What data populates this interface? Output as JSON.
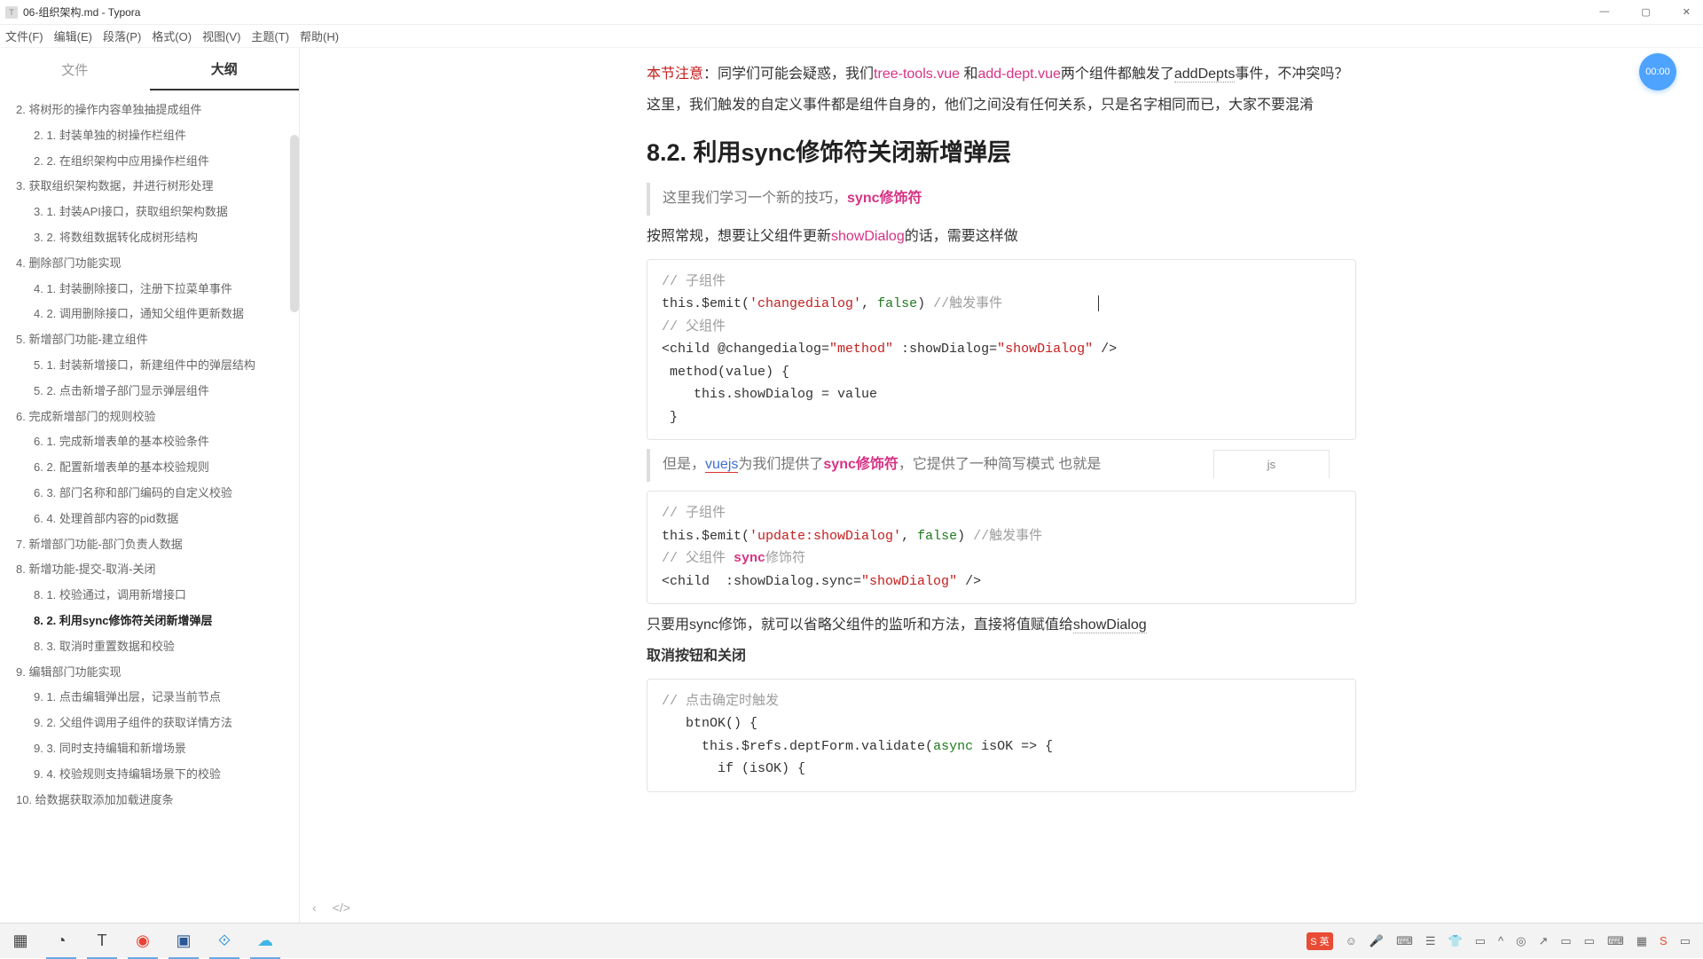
{
  "titlebar": {
    "icon": "T",
    "title": "06-组织架构.md - Typora"
  },
  "winbtns": {
    "min": "—",
    "max": "▢",
    "close": "✕"
  },
  "menus": [
    "文件(F)",
    "编辑(E)",
    "段落(P)",
    "格式(O)",
    "视图(V)",
    "主题(T)",
    "帮助(H)"
  ],
  "sideTabs": {
    "file": "文件",
    "outline": "大纲"
  },
  "outline": [
    {
      "n": "2.",
      "t": "将树形的操作内容单独抽提成组件",
      "l": 1
    },
    {
      "n": "2. 1.",
      "t": "封装单独的树操作栏组件",
      "l": 2
    },
    {
      "n": "2. 2.",
      "t": "在组织架构中应用操作栏组件",
      "l": 2
    },
    {
      "n": "3.",
      "t": "获取组织架构数据，并进行树形处理",
      "l": 1
    },
    {
      "n": "3. 1.",
      "t": "封装API接口，获取组织架构数据",
      "l": 2
    },
    {
      "n": "3. 2.",
      "t": "将数组数据转化成树形结构",
      "l": 2
    },
    {
      "n": "4.",
      "t": "删除部门功能实现",
      "l": 1
    },
    {
      "n": "4. 1.",
      "t": "封装删除接口，注册下拉菜单事件",
      "l": 2
    },
    {
      "n": "4. 2.",
      "t": "调用删除接口，通知父组件更新数据",
      "l": 2
    },
    {
      "n": "5.",
      "t": "新增部门功能-建立组件",
      "l": 1
    },
    {
      "n": "5. 1.",
      "t": "封装新增接口，新建组件中的弹层结构",
      "l": 2
    },
    {
      "n": "5. 2.",
      "t": "点击新增子部门显示弹层组件",
      "l": 2
    },
    {
      "n": "6.",
      "t": "完成新增部门的规则校验",
      "l": 1
    },
    {
      "n": "6. 1.",
      "t": "完成新增表单的基本校验条件",
      "l": 2
    },
    {
      "n": "6. 2.",
      "t": "配置新增表单的基本校验规则",
      "l": 2
    },
    {
      "n": "6. 3.",
      "t": "部门名称和部门编码的自定义校验",
      "l": 2
    },
    {
      "n": "6. 4.",
      "t": "处理首部内容的pid数据",
      "l": 2
    },
    {
      "n": "7.",
      "t": "新增部门功能-部门负责人数据",
      "l": 1
    },
    {
      "n": "8.",
      "t": "新增功能-提交-取消-关闭",
      "l": 1
    },
    {
      "n": "8. 1.",
      "t": "校验通过，调用新增接口",
      "l": 2
    },
    {
      "n": "8. 2.",
      "t": "利用sync修饰符关闭新增弹层",
      "l": 2,
      "a": true
    },
    {
      "n": "8. 3.",
      "t": "取消时重置数据和校验",
      "l": 2
    },
    {
      "n": "9.",
      "t": "编辑部门功能实现",
      "l": 1
    },
    {
      "n": "9. 1.",
      "t": "点击编辑弹出层，记录当前节点",
      "l": 2
    },
    {
      "n": "9. 2.",
      "t": "父组件调用子组件的获取详情方法",
      "l": 2
    },
    {
      "n": "9. 3.",
      "t": "同时支持编辑和新增场景",
      "l": 2
    },
    {
      "n": "9. 4.",
      "t": "校验规则支持编辑场景下的校验",
      "l": 2
    },
    {
      "n": "10.",
      "t": "给数据获取添加加载进度条",
      "l": 1
    }
  ],
  "doc": {
    "note_label": "本节注意",
    "note_colon": "：",
    "note1a": "同学们可能会疑惑，我们",
    "note1b": "tree-tools.vue",
    "note1c": "和",
    "note1d": "add-dept.vue",
    "note1e": "两个组件都触发了",
    "note1f": "addDepts",
    "note1g": "事件，不冲突吗？",
    "p2": "这里，我们触发的自定义事件都是组件自身的，他们之间没有任何关系，只是名字相同而已，大家不要混淆",
    "h2": "8.2. 利用sync修饰符关闭新增弹层",
    "quote1a": "这里我们学习一个新的技巧，",
    "quote1b": "sync修饰符",
    "p3a": "按照常规，想要让父组件更新",
    "p3b": "showDialog",
    "p3c": "的话，需要这样做",
    "code1_c1": "// 子组件",
    "code1_l2a": "this",
    "code1_l2b": ".$emit(",
    "code1_l2c": "'changedialog'",
    "code1_l2d": ", ",
    "code1_l2e": "false",
    "code1_l2f": ") ",
    "code1_l2g": "//触发事件",
    "code1_c2": "// 父组件",
    "code1_l4a": "<child @changedialog=",
    "code1_l4b": "\"method\"",
    "code1_l4c": " :showDialog=",
    "code1_l4d": "\"showDialog\"",
    "code1_l4e": " />",
    "code1_l5": " method(value) {",
    "code1_l6": "    this.showDialog = value",
    "code1_l7": " }",
    "quote2a": "但是，",
    "quote2b": "vuejs",
    "quote2c": "为我们提供了",
    "quote2d": "sync修饰符",
    "quote2e": "，它提供了一种简写模式 也就是",
    "jslabel": "js",
    "code2_c1": "// 子组件",
    "code2_l2a": "this",
    "code2_l2b": ".$emit(",
    "code2_l2c": "'update:showDialog'",
    "code2_l2d": ", ",
    "code2_l2e": "false",
    "code2_l2f": ") ",
    "code2_l2g": "//触发事件",
    "code2_c2a": "// 父组件 ",
    "code2_c2b": "sync",
    "code2_c2c": "修饰符",
    "code2_l4a": "<child  :showDialog.sync=",
    "code2_l4b": "\"showDialog\"",
    "code2_l4c": " />",
    "p4a": "只要用sync修饰，就可以省略父组件的监听和方法，直接将值赋值给",
    "p4b": "showDialog",
    "h3": "取消按钮和关闭",
    "code3_c1": "// 点击确定时触发",
    "code3_l2": "   btnOK() {",
    "code3_l3a": "     this",
    "code3_l3b": ".$refs.deptForm.validate(",
    "code3_l3c": "async",
    "code3_l3d": " isOK ",
    "code3_l3e": "=>",
    "code3_l3f": " {",
    "code3_l4a": "       if",
    "code3_l4b": " (isOK) {"
  },
  "timer": "00:00",
  "nav": {
    "back": "‹",
    "src": "</>"
  },
  "tray": {
    "ime": "S 英",
    "up": "^",
    "o": "◎",
    "a": "↗",
    "b": "▭",
    "c": "▭",
    "d": "▭",
    "e": "⌨",
    "f": "▦",
    "g": "S",
    "h": "▭",
    "end": "▭"
  }
}
